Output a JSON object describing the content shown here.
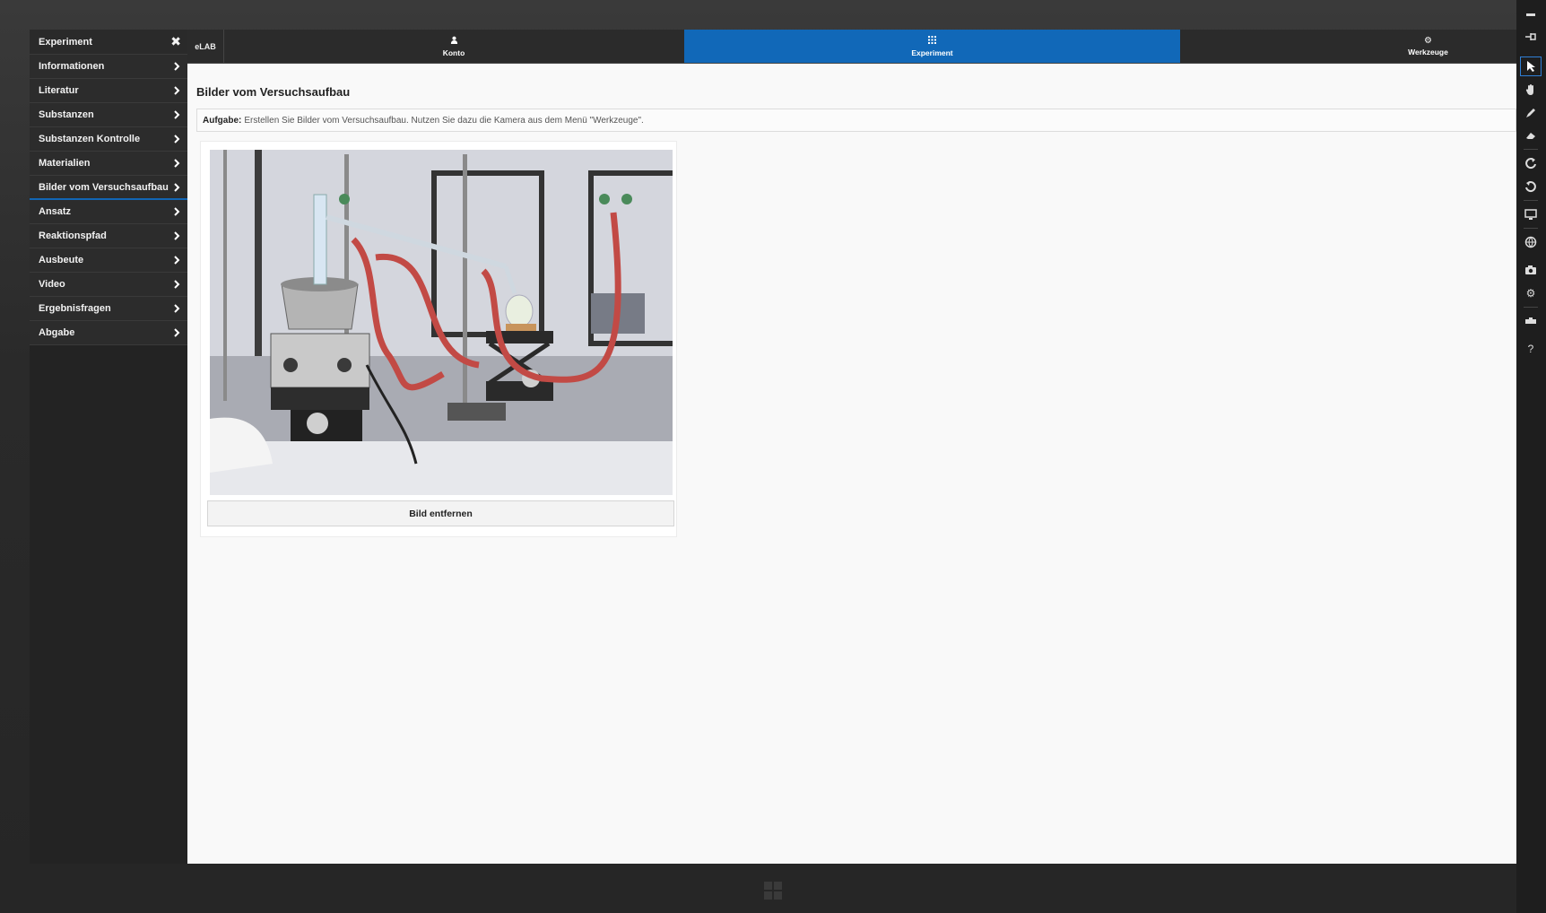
{
  "sidebar": {
    "header_label": "Experiment",
    "items": [
      {
        "label": "Informationen"
      },
      {
        "label": "Literatur"
      },
      {
        "label": "Substanzen"
      },
      {
        "label": "Substanzen Kontrolle"
      },
      {
        "label": "Materialien"
      },
      {
        "label": "Bilder vom Versuchsaufbau"
      },
      {
        "label": "Ansatz"
      },
      {
        "label": "Reaktionspfad"
      },
      {
        "label": "Ausbeute"
      },
      {
        "label": "Video"
      },
      {
        "label": "Ergebnisfragen"
      },
      {
        "label": "Abgabe"
      }
    ]
  },
  "topnav": {
    "brand": "eLAB",
    "tabs": [
      {
        "label": "Konto",
        "icon": "user-icon"
      },
      {
        "label": "Experiment",
        "icon": "grid-icon"
      },
      {
        "label": "Werkzeuge",
        "icon": "gear-icon"
      }
    ],
    "active_color": "#1168b8"
  },
  "main": {
    "title": "Bilder vom Versuchsaufbau",
    "task_label": "Aufgabe:",
    "task_text": "Erstellen Sie Bilder vom Versuchsaufbau. Nutzen Sie dazu die Kamera aus dem Menü \"Werkzeuge\".",
    "remove_button": "Bild entfernen"
  },
  "toolbar_icons": [
    "minimize-icon",
    "pin-icon",
    "pointer-icon",
    "hand-icon",
    "pen-icon",
    "eraser-icon",
    "redo-icon",
    "undo-icon",
    "screen-icon",
    "globe-icon",
    "camera-icon",
    "settings-icon",
    "keyboard-icon",
    "help-icon"
  ]
}
